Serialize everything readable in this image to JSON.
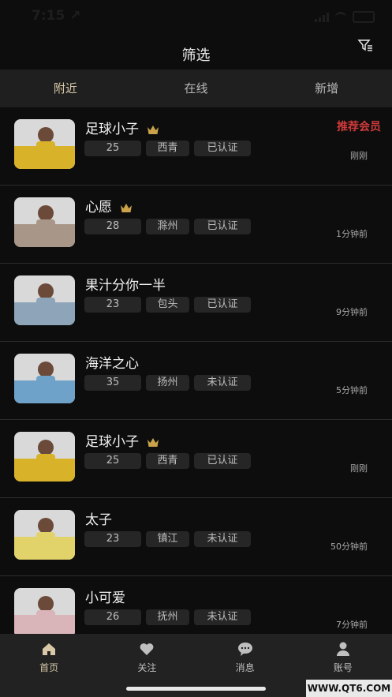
{
  "status_bar": {
    "time": "7:15 ↗"
  },
  "header": {
    "title": "筛选",
    "filter_icon": "filter-icon"
  },
  "tabs": [
    {
      "label": "附近",
      "active": true
    },
    {
      "label": "在线",
      "active": false
    },
    {
      "label": "新增",
      "active": false
    }
  ],
  "users": [
    {
      "name": "足球小子",
      "vip": true,
      "age": "25",
      "city": "西青",
      "verify": "已认证",
      "time": "刚刚",
      "badge": "推荐会员",
      "avatar_tone": "#d8b32a"
    },
    {
      "name": "心愿",
      "vip": true,
      "age": "28",
      "city": "滁州",
      "verify": "已认证",
      "time": "1分钟前",
      "badge": "",
      "avatar_tone": "#a89688"
    },
    {
      "name": "果汁分你一半",
      "vip": false,
      "age": "23",
      "city": "包头",
      "verify": "已认证",
      "time": "9分钟前",
      "badge": "",
      "avatar_tone": "#8ea4b8"
    },
    {
      "name": "海洋之心",
      "vip": false,
      "age": "35",
      "city": "扬州",
      "verify": "未认证",
      "time": "5分钟前",
      "badge": "",
      "avatar_tone": "#6fa2c9"
    },
    {
      "name": "足球小子",
      "vip": true,
      "age": "25",
      "city": "西青",
      "verify": "已认证",
      "time": "刚刚",
      "badge": "",
      "avatar_tone": "#d8b32a"
    },
    {
      "name": "太子",
      "vip": false,
      "age": "23",
      "city": "镇江",
      "verify": "未认证",
      "time": "50分钟前",
      "badge": "",
      "avatar_tone": "#e1d36a"
    },
    {
      "name": "小可爱",
      "vip": false,
      "age": "26",
      "city": "抚州",
      "verify": "未认证",
      "time": "7分钟前",
      "badge": "",
      "avatar_tone": "#d9b4b8"
    }
  ],
  "bottom_nav": [
    {
      "label": "首页",
      "icon": "home-icon",
      "active": true
    },
    {
      "label": "关注",
      "icon": "heart-icon",
      "active": false
    },
    {
      "label": "消息",
      "icon": "chat-icon",
      "active": false
    },
    {
      "label": "账号",
      "icon": "person-icon",
      "active": false
    }
  ],
  "colors": {
    "accent": "#d8c8a8",
    "crown": "#c9a24a",
    "recommend": "#d03a3a"
  },
  "watermark": "WWW.QT6.COM"
}
